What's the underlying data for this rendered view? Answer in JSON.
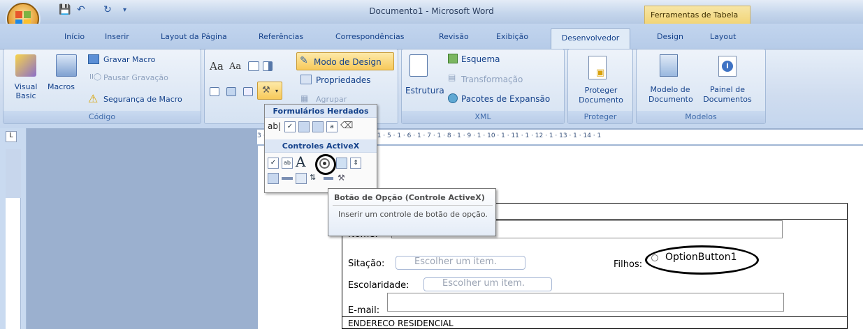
{
  "window": {
    "title": "Documento1 - Microsoft Word",
    "contextual_tab_group": "Ferramentas de Tabela"
  },
  "tabs": [
    "Início",
    "Inserir",
    "Layout da Página",
    "Referências",
    "Correspondências",
    "Revisão",
    "Exibição",
    "Desenvolvedor",
    "Design",
    "Layout"
  ],
  "active_tab": "Desenvolvedor",
  "ribbon": {
    "codigo": {
      "label": "Código",
      "visual_basic": "Visual Basic",
      "macros": "Macros",
      "gravar_macro": "Gravar Macro",
      "pausar_gravacao": "Pausar Gravação",
      "seguranca_macro": "Segurança de Macro"
    },
    "controles": {
      "aa_large": "Aa",
      "aa_small": "Aa",
      "modo_design": "Modo de Design",
      "propriedades": "Propriedades",
      "agrupar": "Agrupar"
    },
    "xml": {
      "label": "XML",
      "estrutura": "Estrutura",
      "esquema": "Esquema",
      "transformacao": "Transformação",
      "pacotes": "Pacotes de Expansão"
    },
    "proteger": {
      "label": "Proteger",
      "proteger_documento": "Proteger Documento"
    },
    "modelos": {
      "label": "Modelos",
      "modelo_documento": "Modelo de Documento",
      "painel_documentos": "Painel de Documentos"
    }
  },
  "legacy_popup": {
    "heading_herdados": "Formulários Herdados",
    "heading_activex": "Controles ActiveX"
  },
  "tooltip": {
    "title": "Botão de Opção (Controle ActiveX)",
    "description": "Inserir um controle de botão de opção."
  },
  "ruler": {
    "marks": "3 · 1 · 2 · 1 · 1 · 1 · 1 · 2 · 1 · 3 · 1 · 4 · 1 · 5 · 1 · 6 · 1 · 7 · 1 · 8 · 1 · 9 · 1 · 10 · 1 · 11 · 1 · 12 · 1 · 13 · 1 · 14 · 1"
  },
  "form": {
    "nome_label": "Nome:",
    "situacao_label": "Sitação:",
    "situacao_placeholder": "Escolher um item.",
    "filhos_label": "Filhos:",
    "option_button": "OptionButton1",
    "escolaridade_label": "Escolaridade:",
    "escolaridade_placeholder": "Escolher um item.",
    "email_label": "E-mail:",
    "endereco_header": "ENDERECO RESIDENCIAL"
  }
}
